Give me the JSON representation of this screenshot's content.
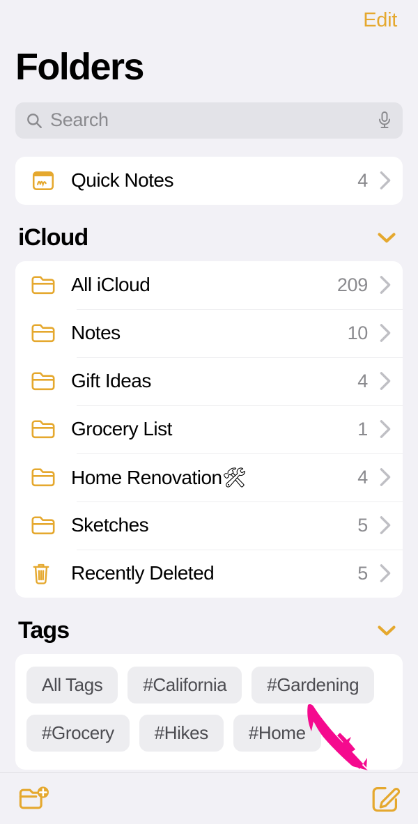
{
  "app": {
    "title": "Folders",
    "edit_label": "Edit"
  },
  "search": {
    "placeholder": "Search",
    "search_icon": "search-icon",
    "mic_icon": "microphone-icon"
  },
  "quick": {
    "rows": [
      {
        "label": "Quick Notes",
        "count": "4",
        "icon": "quick-note-icon"
      }
    ]
  },
  "icloud": {
    "title": "iCloud",
    "collapse_icon": "chevron-down-icon",
    "rows": [
      {
        "label": "All iCloud",
        "count": "209",
        "icon": "folder-icon"
      },
      {
        "label": "Notes",
        "count": "10",
        "icon": "folder-icon"
      },
      {
        "label": "Gift Ideas",
        "count": "4",
        "icon": "folder-icon"
      },
      {
        "label": "Grocery List",
        "count": "1",
        "icon": "folder-icon"
      },
      {
        "label": "Home Renovation🛠",
        "count": "4",
        "icon": "folder-icon"
      },
      {
        "label": "Sketches",
        "count": "5",
        "icon": "folder-icon"
      },
      {
        "label": "Recently Deleted",
        "count": "5",
        "icon": "trash-icon"
      }
    ]
  },
  "tags": {
    "title": "Tags",
    "collapse_icon": "chevron-down-icon",
    "row1": [
      "All Tags",
      "#California",
      "#Gardening"
    ],
    "row2": [
      "#Grocery",
      "#Hikes",
      "#Home"
    ]
  },
  "toolbar": {
    "new_folder_label": "new-folder-icon",
    "compose_label": "compose-note-icon"
  },
  "annotation": {
    "type": "arrow",
    "color": "#F50A8E",
    "points_to": "compose-note-button"
  },
  "colors": {
    "accent": "#E5A82E",
    "background": "#F2F1F6",
    "card": "#FFFFFF",
    "secondary_text": "#8A8A8E",
    "annotation": "#F50A8E"
  }
}
